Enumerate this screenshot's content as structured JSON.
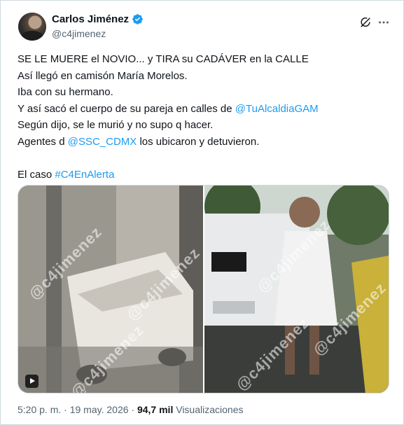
{
  "author": {
    "name": "Carlos Jiménez",
    "handle": "@c4jimenez"
  },
  "tweet": {
    "lines": [
      [
        {
          "t": "SE LE MUERE el NOVIO... y TIRA su CADÁVER en la CALLE",
          "link": false
        }
      ],
      [
        {
          "t": "Así llegó en camisón María Morelos.",
          "link": false
        }
      ],
      [
        {
          "t": "Iba con su hermano.",
          "link": false
        }
      ],
      [
        {
          "t": "Y así sacó el cuerpo de su pareja en calles de ",
          "link": false
        },
        {
          "t": "@TuAlcaldiaGAM",
          "link": true
        }
      ],
      [
        {
          "t": "Según dijo, se le murió y no supo q hacer.",
          "link": false
        }
      ],
      [
        {
          "t": "Agentes d ",
          "link": false
        },
        {
          "t": "@SSC_CDMX",
          "link": true
        },
        {
          "t": " los ubicaron y detuvieron.",
          "link": false
        }
      ],
      [],
      [
        {
          "t": "El caso ",
          "link": false
        },
        {
          "t": "#C4EnAlerta",
          "link": true
        }
      ]
    ]
  },
  "media": {
    "watermark": "@c4jimenez",
    "videos": [
      "video-1",
      "video-2"
    ]
  },
  "footer": {
    "time": "5:20 p. m.",
    "sep": "·",
    "date": "19 may. 2026",
    "views_count": "94,7 mil",
    "views_label": "Visualizaciones"
  },
  "colors": {
    "link": "#1d9bf0",
    "verified": "#1d9bf0",
    "text": "#0f1419",
    "muted": "#536471"
  },
  "icons": [
    "verified-badge-icon",
    "grok-icon",
    "more-icon",
    "play-icon"
  ]
}
